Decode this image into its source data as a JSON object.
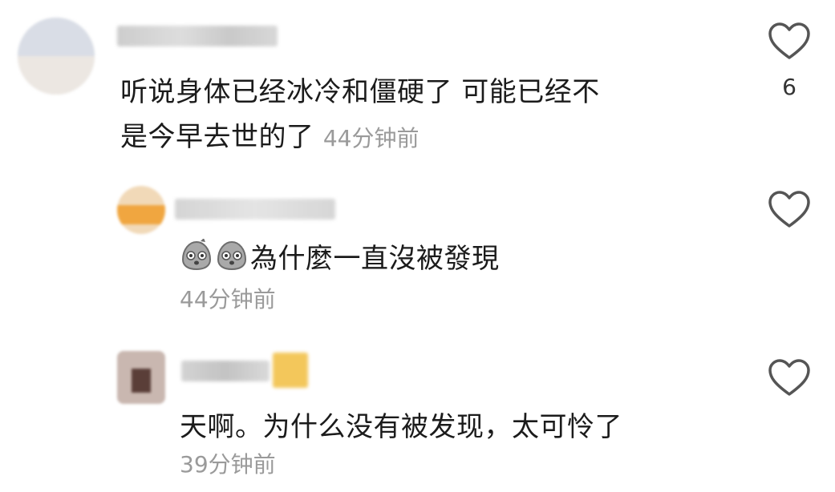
{
  "comments": [
    {
      "text": "听说身体已经冰冷和僵硬了 可能已经不",
      "text_line2": "是今早去世的了",
      "time": "44分钟前",
      "likes": "6",
      "reply": false
    },
    {
      "emojis": [
        "shocked-sticker-emoji",
        "shocked-sticker-emoji"
      ],
      "text": "為什麼一直沒被發現",
      "time": "44分钟前",
      "reply": true
    },
    {
      "text": "天啊。为什么没有被发现，太可怜了",
      "time": "39分钟前",
      "reply": true
    }
  ],
  "icons": {
    "like": "heart-outline-icon"
  },
  "colors": {
    "text": "#1b1b1b",
    "timestamp": "#9a9a9a",
    "icon": "#555555"
  }
}
